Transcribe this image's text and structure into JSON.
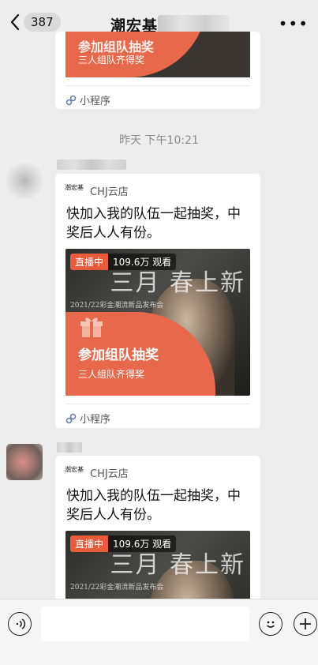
{
  "header": {
    "back_count": "387",
    "title": "潮宏基"
  },
  "messages": [
    {
      "kind": "partial",
      "banner_sub": "三人组队齐得奖",
      "mini_program_label": "小程序"
    },
    {
      "kind": "full",
      "source": "CHJ云店",
      "logo_text": "潮宏基",
      "description": "快加入我的队伍一起抽奖，中奖后人人有份。",
      "live_status": "直播中",
      "viewers": "109.6万 观看",
      "overlay_main": "三月 春上新",
      "overlay_sub": "2021/22彩金潮流新品发布会",
      "banner_title": "参加组队抽奖",
      "banner_sub": "三人组队齐得奖",
      "mini_program_label": "小程序"
    },
    {
      "kind": "partial-bottom",
      "source": "CHJ云店",
      "logo_text": "潮宏基",
      "description": "快加入我的队伍一起抽奖，中奖后人人有份。",
      "live_status": "直播中",
      "viewers": "109.6万 观看",
      "overlay_main": "三月 春上新",
      "overlay_sub": "2021/22彩金潮流新品发布会"
    }
  ],
  "timestamp": "昨天 下午10:21",
  "icons": {
    "back": "chevron-left-icon",
    "more": "more-dots-icon",
    "voice": "voice-icon",
    "emoji": "emoji-icon",
    "add": "add-icon",
    "mini_program": "mini-program-icon",
    "gift": "gift-icon"
  },
  "colors": {
    "banner": "#e8684b",
    "live_badge": "#e95b3c",
    "background": "#ededed"
  }
}
